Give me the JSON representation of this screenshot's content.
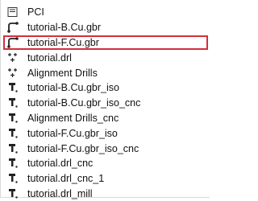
{
  "items": [
    {
      "label": "PCI",
      "icon": "folder-icon",
      "selected": false
    },
    {
      "label": "tutorial-B.Cu.gbr",
      "icon": "gerber-icon",
      "selected": false
    },
    {
      "label": "tutorial-F.Cu.gbr",
      "icon": "gerber-icon",
      "selected": true
    },
    {
      "label": "tutorial.drl",
      "icon": "drill-icon",
      "selected": false
    },
    {
      "label": "Alignment Drills",
      "icon": "drill-icon",
      "selected": false
    },
    {
      "label": "tutorial-B.Cu.gbr_iso",
      "icon": "cnc-icon",
      "selected": false
    },
    {
      "label": "tutorial-B.Cu.gbr_iso_cnc",
      "icon": "cnc-icon",
      "selected": false
    },
    {
      "label": "Alignment Drills_cnc",
      "icon": "cnc-icon",
      "selected": false
    },
    {
      "label": "tutorial-F.Cu.gbr_iso",
      "icon": "cnc-icon",
      "selected": false
    },
    {
      "label": "tutorial-F.Cu.gbr_iso_cnc",
      "icon": "cnc-icon",
      "selected": false
    },
    {
      "label": "tutorial.drl_cnc",
      "icon": "cnc-icon",
      "selected": false
    },
    {
      "label": "tutorial.drl_cnc_1",
      "icon": "cnc-icon",
      "selected": false
    },
    {
      "label": "tutorial.drl_mill",
      "icon": "cnc-icon",
      "selected": false
    }
  ],
  "colors": {
    "selection_outline": "#d32f3b",
    "text": "#111111",
    "background": "#ffffff"
  }
}
